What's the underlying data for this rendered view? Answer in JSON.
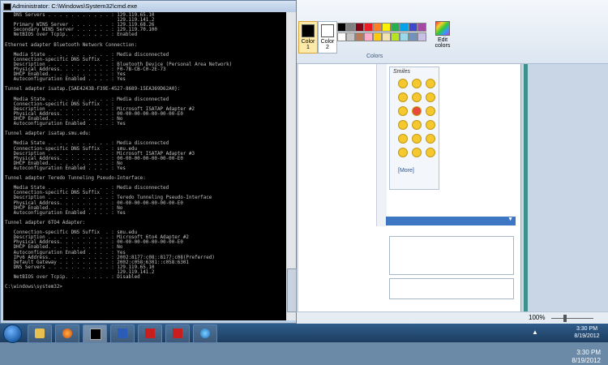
{
  "cmd": {
    "title": "Administrator: C:\\Windows\\System32\\cmd.exe",
    "lines": [
      "   DNS Servers . . . . . . . . . . . : 129.119.65.10",
      "                                       129.119.141.2",
      "   Primary WINS Server . . . . . . . : 129.119.68.26",
      "   Secondary WINS Server . . . . . . : 129.119.70.100",
      "   NetBIOS over Tcpip. . . . . . . . : Enabled",
      "",
      "Ethernet adapter Bluetooth Network Connection:",
      "",
      "   Media State . . . . . . . . . . . : Media disconnected",
      "   Connection-specific DNS Suffix  . :",
      "   Description . . . . . . . . . . . : Bluetooth Device (Personal Area Network)",
      "   Physical Address. . . . . . . . . : F0-7B-CB-C0-2E-73",
      "   DHCP Enabled. . . . . . . . . . . : Yes",
      "   Autoconfiguration Enabled . . . . : Yes",
      "",
      "Tunnel adapter isatap.{5AE4243B-F39E-4527-8689-15EA369D62A0}:",
      "",
      "   Media State . . . . . . . . . . . : Media disconnected",
      "   Connection-specific DNS Suffix  . :",
      "   Description . . . . . . . . . . . : Microsoft ISATAP Adapter #2",
      "   Physical Address. . . . . . . . . : 00-00-00-00-00-00-00-E0",
      "   DHCP Enabled. . . . . . . . . . . : No",
      "   Autoconfiguration Enabled . . . . : Yes",
      "",
      "Tunnel adapter isatap.smu.edu:",
      "",
      "   Media State . . . . . . . . . . . : Media disconnected",
      "   Connection-specific DNS Suffix  . : smu.edu",
      "   Description . . . . . . . . . . . : Microsoft ISATAP Adapter #3",
      "   Physical Address. . . . . . . . . : 00-00-00-00-00-00-00-E0",
      "   DHCP Enabled. . . . . . . . . . . : No",
      "   Autoconfiguration Enabled . . . . : Yes",
      "",
      "Tunnel adapter Teredo Tunneling Pseudo-Interface:",
      "",
      "   Media State . . . . . . . . . . . : Media disconnected",
      "   Connection-specific DNS Suffix  . :",
      "   Description . . . . . . . . . . . : Teredo Tunneling Pseudo-Interface",
      "   Physical Address. . . . . . . . . : 00-00-00-00-00-00-00-E0",
      "   DHCP Enabled. . . . . . . . . . . : No",
      "   Autoconfiguration Enabled . . . . : Yes",
      "",
      "Tunnel adapter 6TO4 Adapter:",
      "",
      "   Connection-specific DNS Suffix  . : smu.edu",
      "   Description . . . . . . . . . . . : Microsoft 6to4 Adapter #2",
      "   Physical Address. . . . . . . . . : 00-00-00-00-00-00-00-E0",
      "   DHCP Enabled. . . . . . . . . . . : No",
      "   Autoconfiguration Enabled . . . . : Yes",
      "   IPv6 Address. . . . . . . . . . . : 2002:8177:c08::8177:c08(Preferred)",
      "   Default Gateway . . . . . . . . . : 2002:c058:6301::c058:6301",
      "   DNS Servers . . . . . . . . . . . : 129.119.65.10",
      "                                       129.119.141.2",
      "   NetBIOS over Tcpip. . . . . . . . : Disabled",
      "",
      "C:\\windows\\system32>"
    ]
  },
  "paint": {
    "color1_label": "Color\n1",
    "color2_label": "Color\n2",
    "colors_group_label": "Colors",
    "edit_colors_label": "Edit\ncolors",
    "palette": [
      "#000000",
      "#7f7f7f",
      "#880015",
      "#ed1c24",
      "#ff7f27",
      "#fff200",
      "#22b14c",
      "#00a2e8",
      "#3f48cc",
      "#a349a4",
      "#ffffff",
      "#c3c3c3",
      "#b97a57",
      "#ffaec9",
      "#ffc90e",
      "#efe4b0",
      "#b5e61d",
      "#99d9ea",
      "#7092be",
      "#c8bfe7"
    ],
    "zoom_label": "100%",
    "small_time": "3:30 PM",
    "small_date": "8/19/2012"
  },
  "smiles": {
    "header": "Smiles",
    "more_link": "[More]"
  },
  "taskbar": {
    "time": "3:30 PM",
    "date": "8/19/2012"
  }
}
